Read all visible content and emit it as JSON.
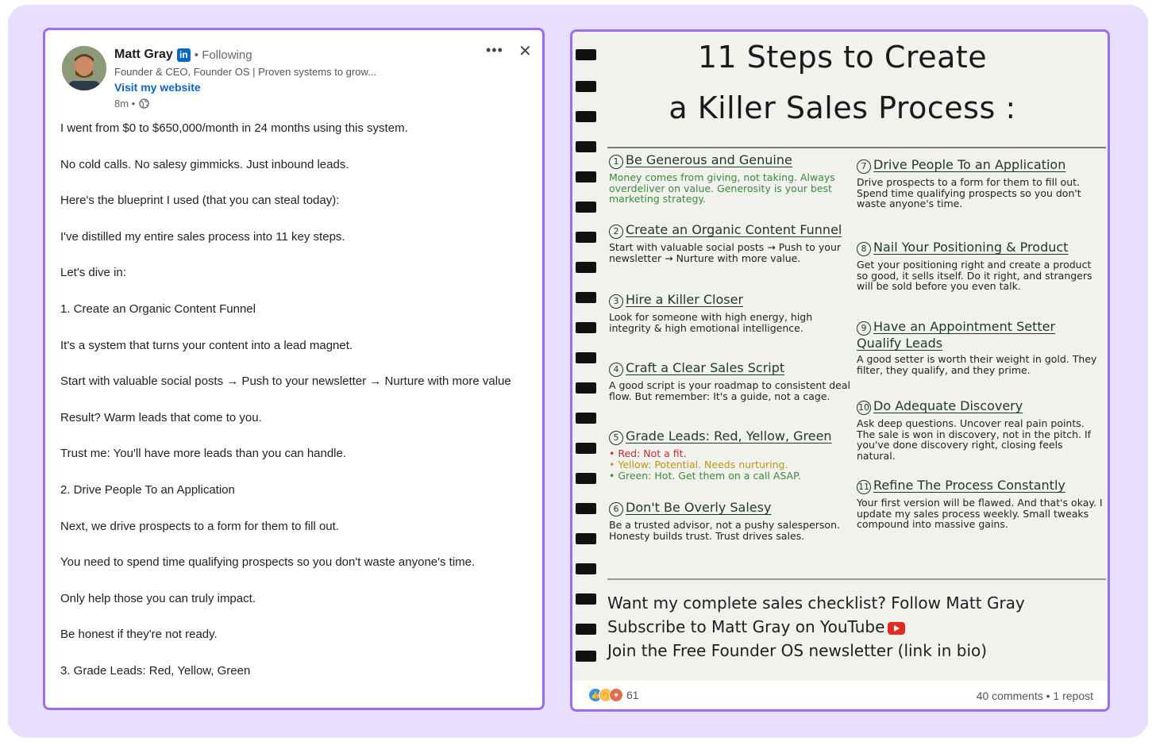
{
  "post": {
    "author": "Matt Gray",
    "linkedin_badge": "in",
    "following": "• Following",
    "headline": "Founder & CEO, Founder OS | Proven systems to grow...",
    "website_link": "Visit my website",
    "time": "8m •",
    "more_label": "•••",
    "close_label": "✕",
    "paragraphs": [
      "I went from $0 to $650,000/month in 24 months using this system.",
      "No cold calls. No salesy gimmicks. Just inbound leads.",
      "Here's the blueprint I used (that you can steal today):",
      "I've distilled my entire sales process into 11 key steps.",
      "Let's dive in:",
      "1. Create an Organic Content Funnel",
      "It's a system that turns your content into a lead magnet.",
      "Start with valuable social posts → Push to your newsletter → Nurture with more value",
      "Result? Warm leads that come to you.",
      "Trust me: You'll have more leads than you can handle.",
      "2. Drive People To an Application",
      "Next, we drive prospects to a form for them to fill out.",
      "You need to spend time qualifying prospects so you don't waste anyone's time.",
      "Only help those you can truly impact.",
      "Be honest if they're not ready.",
      "3. Grade Leads: Red, Yellow, Green"
    ]
  },
  "image": {
    "title_line1": "11 Steps to Create",
    "title_line2": "a Killer Sales Process :",
    "left_steps": [
      {
        "num": "1",
        "title": "Be Generous and Genuine",
        "desc": "Money comes from giving, not taking. Always overdeliver on value. Generosity is your best marketing strategy."
      },
      {
        "num": "2",
        "title": "Create an Organic Content Funnel",
        "desc": "Start with valuable social posts → Push to your newsletter → Nurture with more value."
      },
      {
        "num": "3",
        "title": "Hire a Killer Closer",
        "desc": "Look for someone with high energy, high integrity & high emotional intelligence."
      },
      {
        "num": "4",
        "title": "Craft a Clear Sales Script",
        "desc": "A good script is your roadmap to consistent deal flow. But remember: It's a guide, not a cage."
      },
      {
        "num": "5",
        "title": "Grade Leads: Red, Yellow, Green",
        "desc": ""
      },
      {
        "num": "6",
        "title": "Don't Be Overly Salesy",
        "desc": "Be a trusted advisor, not a pushy salesperson. Honesty builds trust. Trust drives sales."
      }
    ],
    "grade_bullets": [
      "Red: Not a fit.",
      "Yellow: Potential. Needs nurturing.",
      "Green: Hot. Get them on a call ASAP."
    ],
    "right_steps": [
      {
        "num": "7",
        "title": "Drive People To an Application",
        "desc": "Drive prospects to a form for them to fill out. Spend time qualifying prospects so you don't waste anyone's time."
      },
      {
        "num": "8",
        "title": "Nail Your Positioning & Product",
        "desc": "Get your positioning right and create a product so good, it sells itself. Do it right, and strangers will be sold before you even talk."
      },
      {
        "num": "9",
        "title": "Have an Appointment Setter Qualify Leads",
        "desc": "A good setter is worth their weight in gold. They filter, they qualify, and they prime."
      },
      {
        "num": "10",
        "title": "Do Adequate Discovery",
        "desc": "Ask deep questions. Uncover real pain points. The sale is won in discovery, not in the pitch. If you've done discovery right, closing feels natural."
      },
      {
        "num": "11",
        "title": "Refine The Process Constantly",
        "desc": "Your first version will be flawed. And that's okay. I update my sales process weekly. Small tweaks compound into massive gains."
      }
    ],
    "cta_lines": [
      "Want my complete sales checklist? Follow Matt Gray",
      "Subscribe to Matt Gray on YouTube",
      "Join the Free Founder OS newsletter (link in bio)"
    ]
  },
  "footer": {
    "reaction_count": "61",
    "comments": "40 comments • 1 repost"
  },
  "colors": {
    "accent_border": "#9b6cf0",
    "background": "#e8deff",
    "link_blue": "#0a66c2",
    "ink_green": "#3a8a3a"
  }
}
